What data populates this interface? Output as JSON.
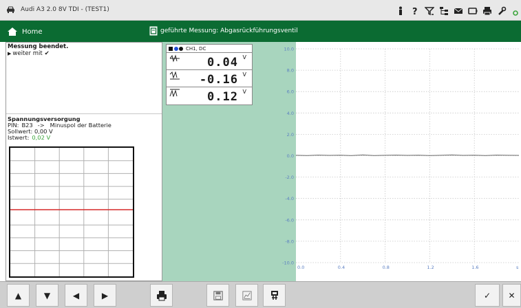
{
  "titlebar": {
    "title": "Audi A3 2.0 8V TDI - (TEST1)",
    "icons": [
      "person-icon",
      "help-icon",
      "filter-icon",
      "tree-icon",
      "mail-icon",
      "battery-icon",
      "print-icon",
      "tools-icon"
    ]
  },
  "greenbar": {
    "home_label": "Home",
    "measure_title": "geführte Messung: Abgasrückführungsventil"
  },
  "message": {
    "title": "Messung beendet.",
    "link": "weiter mit",
    "check": "✔"
  },
  "supply": {
    "title": "Spannungsversorgung",
    "pin_label": "PIN:",
    "pin_value": "B23",
    "pin_arrow": "->",
    "pin_target": "Minuspol der Batterie",
    "soll_label": "Sollwert: 0,00 V",
    "ist_label": "Istwert:",
    "ist_value": "0,02 V"
  },
  "meter": {
    "channel_label": "CH1, DC",
    "rows": [
      {
        "symbol": "average",
        "value": "0.04",
        "unit": "V"
      },
      {
        "symbol": "min",
        "value": "-0.16",
        "unit": "V"
      },
      {
        "symbol": "max",
        "value": "0.12",
        "unit": "V"
      }
    ]
  },
  "colors": {
    "green_bar": "#0b6b32",
    "panel_green": "#a8d5be",
    "minigrid_line": "#d62828",
    "ist_value": "#3aa53a"
  },
  "chart_data": {
    "type": "line",
    "ylabels": [
      "10.0",
      "8.0",
      "6.0",
      "4.0",
      "2.0",
      "0.0",
      "-2.0",
      "-4.0",
      "-6.0",
      "-8.0",
      "-10.0"
    ],
    "xlabels": [
      "0.0",
      "0.4",
      "0.8",
      "1.2",
      "1.6",
      "s"
    ],
    "ylim": [
      -10,
      10
    ],
    "xlim": [
      0,
      2.0
    ],
    "grid": true,
    "series": [
      {
        "x": [
          0.0,
          0.1,
          0.2,
          0.3,
          0.4,
          0.5,
          0.6,
          0.7,
          0.8,
          0.9,
          1.0,
          1.1,
          1.2,
          1.3,
          1.4,
          1.5,
          1.6,
          1.7,
          1.8,
          1.9,
          2.0
        ],
        "values": [
          0.04,
          0.02,
          0.06,
          0.03,
          0.05,
          0.01,
          0.07,
          0.02,
          0.04,
          0.06,
          0.03,
          0.05,
          0.02,
          0.04,
          0.07,
          0.03,
          0.05,
          0.02,
          0.06,
          0.04,
          0.03
        ]
      }
    ]
  },
  "toolbar": {
    "up": "▲",
    "down": "▼",
    "left": "◀",
    "right": "▶",
    "confirm": "✓",
    "close": "✕"
  }
}
